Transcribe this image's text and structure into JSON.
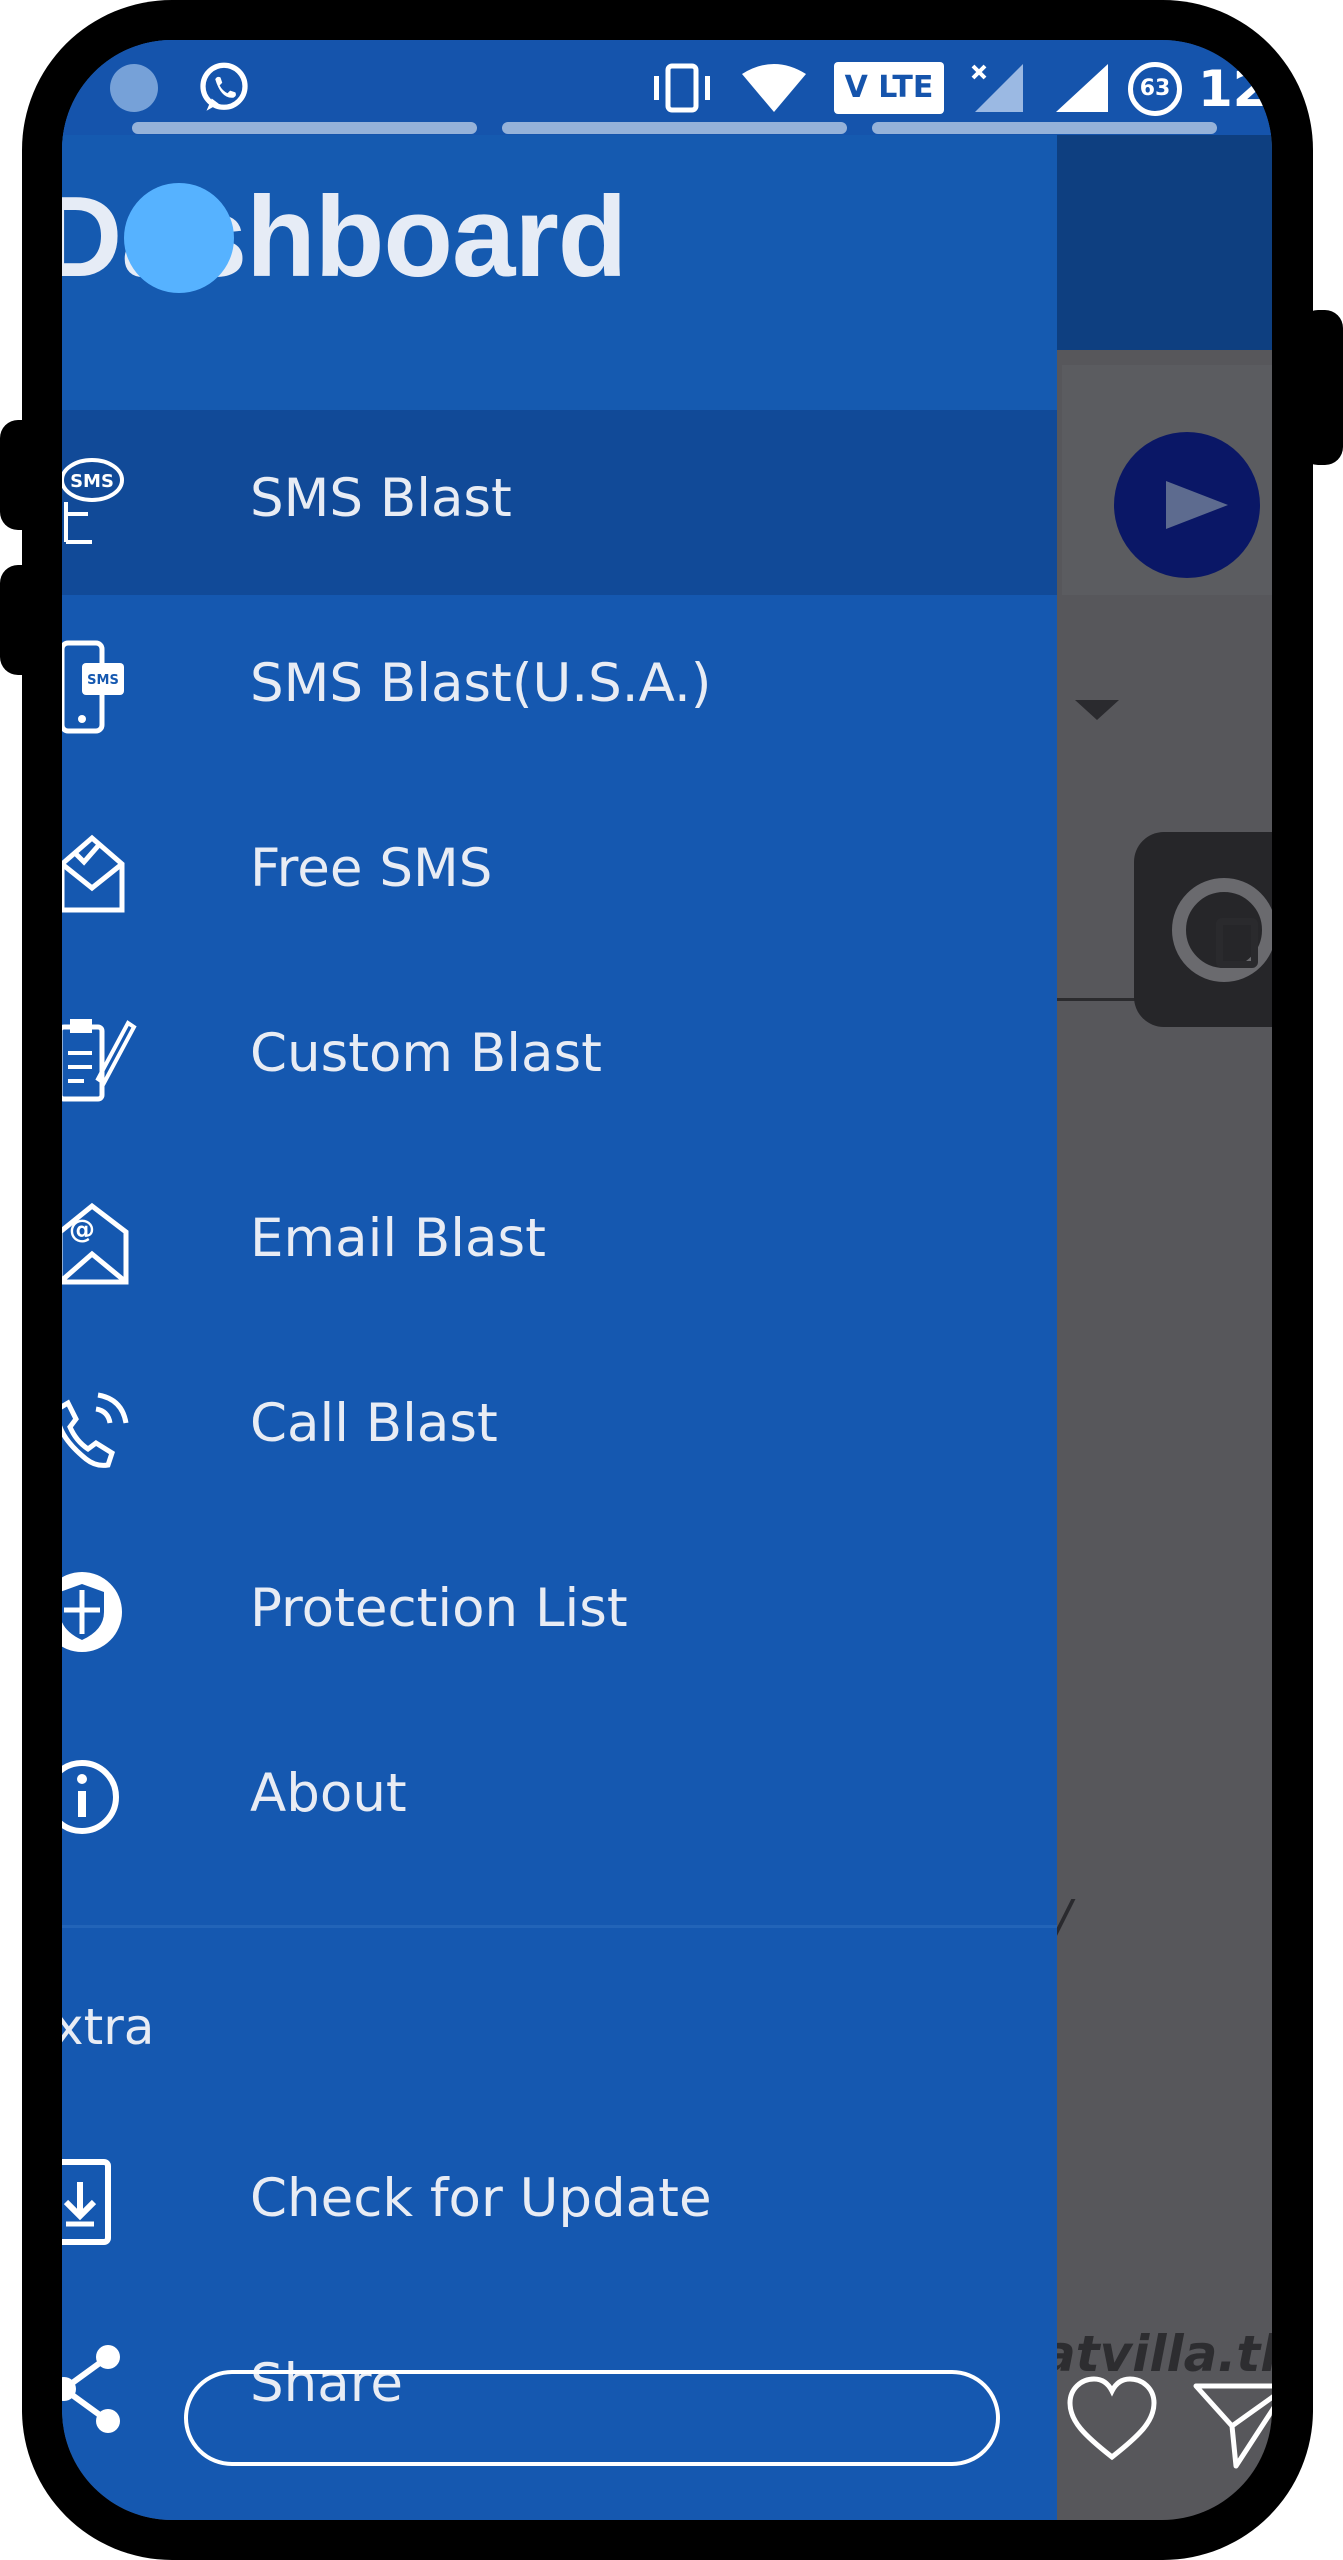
{
  "status_bar": {
    "network_badge": "V LTE",
    "battery_level": "63",
    "clock_partial": "12"
  },
  "drawer": {
    "title": "Dashboard",
    "items": [
      {
        "label": "SMS Blast",
        "icon": "sms-bubble-icon",
        "active": true
      },
      {
        "label": "SMS Blast(U.S.A.)",
        "icon": "phone-sms-icon",
        "active": false
      },
      {
        "label": "Free SMS",
        "icon": "open-envelope-icon",
        "active": false
      },
      {
        "label": "Custom Blast",
        "icon": "clipboard-pen-icon",
        "active": false
      },
      {
        "label": "Email Blast",
        "icon": "email-envelope-icon",
        "active": false
      },
      {
        "label": "Call Blast",
        "icon": "phone-waves-icon",
        "active": false
      },
      {
        "label": "Protection List",
        "icon": "shield-icon",
        "active": false
      },
      {
        "label": "About",
        "icon": "info-icon",
        "active": false
      }
    ],
    "section_title": "xtra",
    "extra_items": [
      {
        "label": "Check for Update",
        "icon": "download-box-icon"
      },
      {
        "label": "Share",
        "icon": "share-icon"
      }
    ]
  },
  "background": {
    "watermark_text": "/",
    "url_text": "atvilla.tk"
  },
  "colors": {
    "drawer": "#1558b0",
    "active_item": "#114a98",
    "toolbar": "#0e3f80",
    "dim_overlay": "#57575b",
    "touch_indicator": "#56b2ff"
  }
}
